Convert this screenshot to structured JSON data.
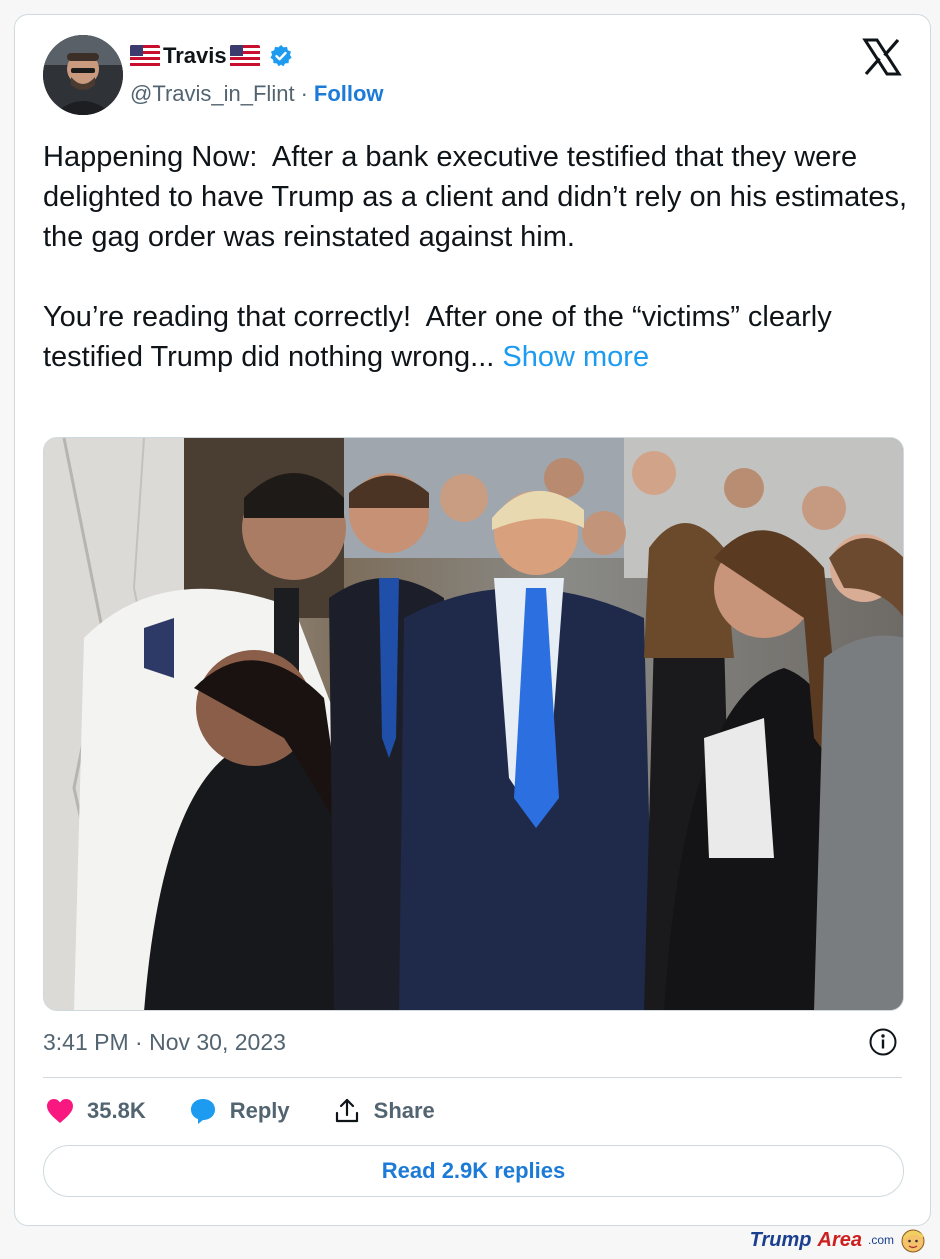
{
  "tweet": {
    "author_name": "Travis",
    "handle": "@Travis_in_Flint",
    "separator": "·",
    "follow_label": "Follow",
    "text_p1": "Happening Now:  After a bank executive testified that they were delighted to have Trump as a client and didn’t rely on his estimates, the gag order was reinstated against him.",
    "text_p2": "You’re reading that correctly!  After one of the “victims” clearly testified Trump did nothing wrong... ",
    "show_more_label": "Show more",
    "timestamp": "3:41 PM · Nov 30, 2023",
    "likes": "35.8K",
    "reply_label": "Reply",
    "share_label": "Share",
    "read_replies_label": "Read 2.9K replies"
  },
  "watermark": {
    "part1": "Trump",
    "part2": "Area",
    "part3": ".com"
  },
  "icons": {
    "verified": "verified-badge-icon",
    "x_logo": "x-logo-icon",
    "info": "info-icon",
    "like": "heart-icon",
    "reply": "speech-bubble-icon",
    "share": "share-upload-icon"
  },
  "colors": {
    "link_blue": "#1d9bf0",
    "like_pink": "#f91880",
    "reply_blue": "#1d9bf0",
    "text": "#0f1419",
    "muted": "#536471"
  }
}
